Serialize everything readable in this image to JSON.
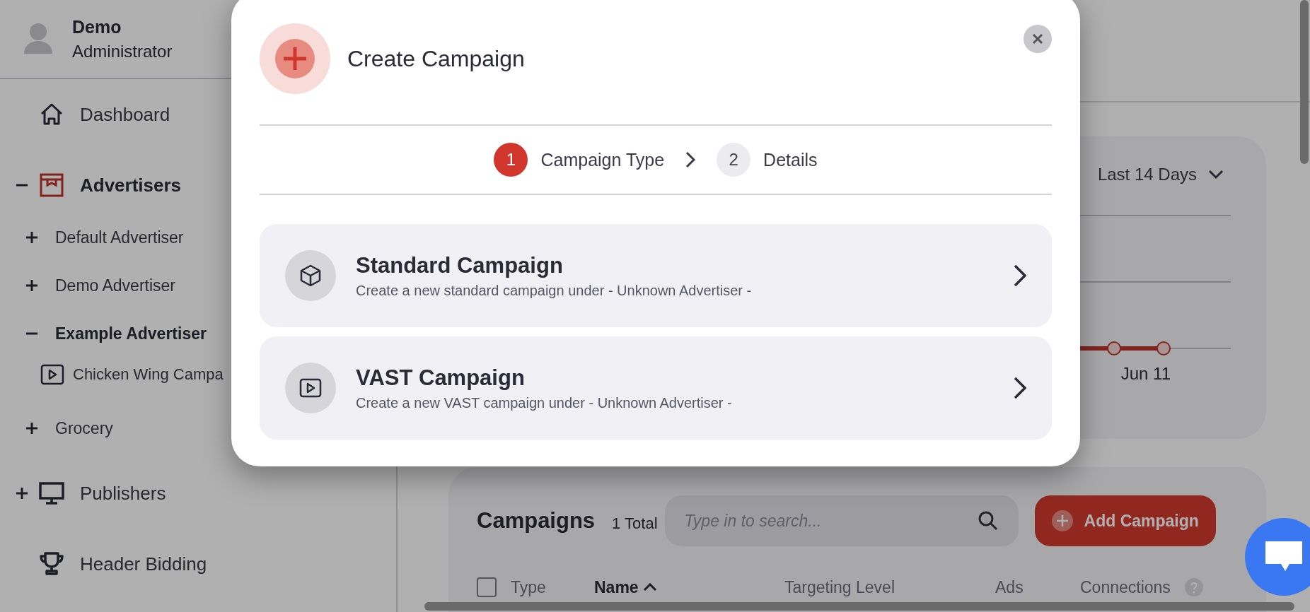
{
  "profile": {
    "name": "Demo",
    "role": "Administrator"
  },
  "sidebar": {
    "items": [
      {
        "label": "Dashboard",
        "selected": false
      },
      {
        "label": "Advertisers",
        "selected": true,
        "expanded": true,
        "children": [
          {
            "label": "Default Advertiser",
            "selected": false,
            "expanded": false
          },
          {
            "label": "Demo Advertiser",
            "selected": false,
            "expanded": false
          },
          {
            "label": "Example Advertiser",
            "selected": true,
            "expanded": true,
            "children": [
              {
                "label": "Chicken Wing Campa",
                "selected": false,
                "kind": "campaign"
              }
            ]
          },
          {
            "label": "Grocery",
            "selected": false,
            "expanded": false
          }
        ]
      },
      {
        "label": "Publishers",
        "selected": false,
        "expanded": false
      },
      {
        "label": "Header Bidding",
        "selected": false
      }
    ]
  },
  "chart_panel": {
    "range": "Last 14 Days",
    "x_label": "Jun 11"
  },
  "campaigns": {
    "title": "Campaigns",
    "total": "1 Total",
    "search": {
      "placeholder": "Type in to search..."
    },
    "add_button": "Add Campaign",
    "select_all": {
      "checked": false
    },
    "columns": [
      {
        "label": "Type",
        "sorted": false
      },
      {
        "label": "Name",
        "sorted": true
      },
      {
        "label": "Targeting Level",
        "sorted": false
      },
      {
        "label": "Ads",
        "sorted": false
      },
      {
        "label": "Connections",
        "sorted": false,
        "help": true
      }
    ]
  },
  "modal": {
    "title": "Create Campaign",
    "steps": [
      {
        "number": "1",
        "label": "Campaign Type",
        "selected": true
      },
      {
        "number": "2",
        "label": "Details",
        "selected": false
      }
    ],
    "options": [
      {
        "kind": "standard",
        "title": "Standard Campaign",
        "description": "Create a new standard campaign under - Unknown Advertiser -"
      },
      {
        "kind": "vast",
        "title": "VAST Campaign",
        "description": "Create a new VAST campaign under - Unknown Advertiser -"
      }
    ]
  }
}
